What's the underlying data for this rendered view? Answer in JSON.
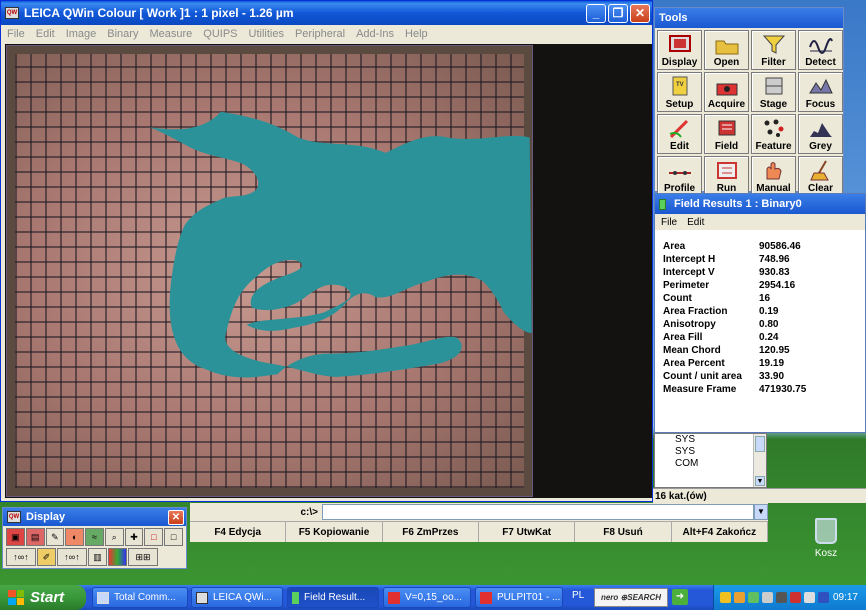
{
  "main_window": {
    "title": "LEICA QWin Colour  [ Work ]1  :  1 pixel - 1.26 µm",
    "menu": [
      "File",
      "Edit",
      "Image",
      "Binary",
      "Measure",
      "QUIPS",
      "Utilities",
      "Peripheral",
      "Add-Ins",
      "Help"
    ]
  },
  "tools": {
    "title": "Tools",
    "buttons": [
      {
        "label": "Display",
        "icon": "display-icon"
      },
      {
        "label": "Open",
        "icon": "folder-open-icon"
      },
      {
        "label": "Filter",
        "icon": "filter-funnel-icon"
      },
      {
        "label": "Detect",
        "icon": "detect-waveform-icon"
      },
      {
        "label": "Setup",
        "icon": "setup-icon"
      },
      {
        "label": "Acquire",
        "icon": "acquire-camera-icon"
      },
      {
        "label": "Stage",
        "icon": "stage-icon"
      },
      {
        "label": "Focus",
        "icon": "focus-icon"
      },
      {
        "label": "Edit",
        "icon": "pencil-icon"
      },
      {
        "label": "Field",
        "icon": "field-icon"
      },
      {
        "label": "Feature",
        "icon": "feature-dots-icon"
      },
      {
        "label": "Grey",
        "icon": "grey-histogram-icon"
      },
      {
        "label": "Profile",
        "icon": "profile-icon"
      },
      {
        "label": "Run",
        "icon": "run-icon"
      },
      {
        "label": "Manual",
        "icon": "manual-hand-icon"
      },
      {
        "label": "Clear",
        "icon": "clear-broom-icon"
      }
    ]
  },
  "results": {
    "title": "Field Results 1 : Binary0",
    "menu": [
      "File",
      "Edit"
    ],
    "rows": [
      {
        "key": "Area",
        "value": "90586.46"
      },
      {
        "key": "Intercept H",
        "value": "748.96"
      },
      {
        "key": "Intercept V",
        "value": "930.83"
      },
      {
        "key": "Perimeter",
        "value": "2954.16"
      },
      {
        "key": "Count",
        "value": "16"
      },
      {
        "key": "Area Fraction",
        "value": "0.19"
      },
      {
        "key": "Anisotropy",
        "value": "0.80"
      },
      {
        "key": "Area Fill",
        "value": "0.24"
      },
      {
        "key": "Mean Chord",
        "value": "120.95"
      },
      {
        "key": "Area Percent",
        "value": "19.19"
      },
      {
        "key": "Count / unit area",
        "value": "33.90"
      },
      {
        "key": "Measure Frame",
        "value": "471930.75"
      }
    ]
  },
  "log": {
    "lines": [
      "SYS",
      "SYS",
      "COM"
    ],
    "status": "16 kat.(ów)"
  },
  "command": {
    "prompt": "c:\\>",
    "value": ""
  },
  "fkeys": [
    "F4 Edycja",
    "F5 Kopiowanie",
    "F6 ZmPrzes",
    "F7 UtwKat",
    "F8 Usuń",
    "Alt+F4 Zakończ"
  ],
  "display_toolbar": {
    "title": "Display",
    "close": "✕"
  },
  "desktop": {
    "recycle_label": "Kosz"
  },
  "taskbar": {
    "start": "Start",
    "items": [
      {
        "label": "Total Comm...",
        "active": false
      },
      {
        "label": "LEICA QWi...",
        "active": false
      },
      {
        "label": "Field Result...",
        "active": true
      },
      {
        "label": "V=0,15_oo...",
        "active": false
      },
      {
        "label": "PULPIT01 - ...",
        "active": false
      }
    ],
    "lang": "PL",
    "nero": "nero ⊕SEARCH",
    "clock": "09:17"
  },
  "colors": {
    "binary_overlay": "#2a9298",
    "xp_blue": "#1158d8",
    "start_green": "#38983a"
  }
}
